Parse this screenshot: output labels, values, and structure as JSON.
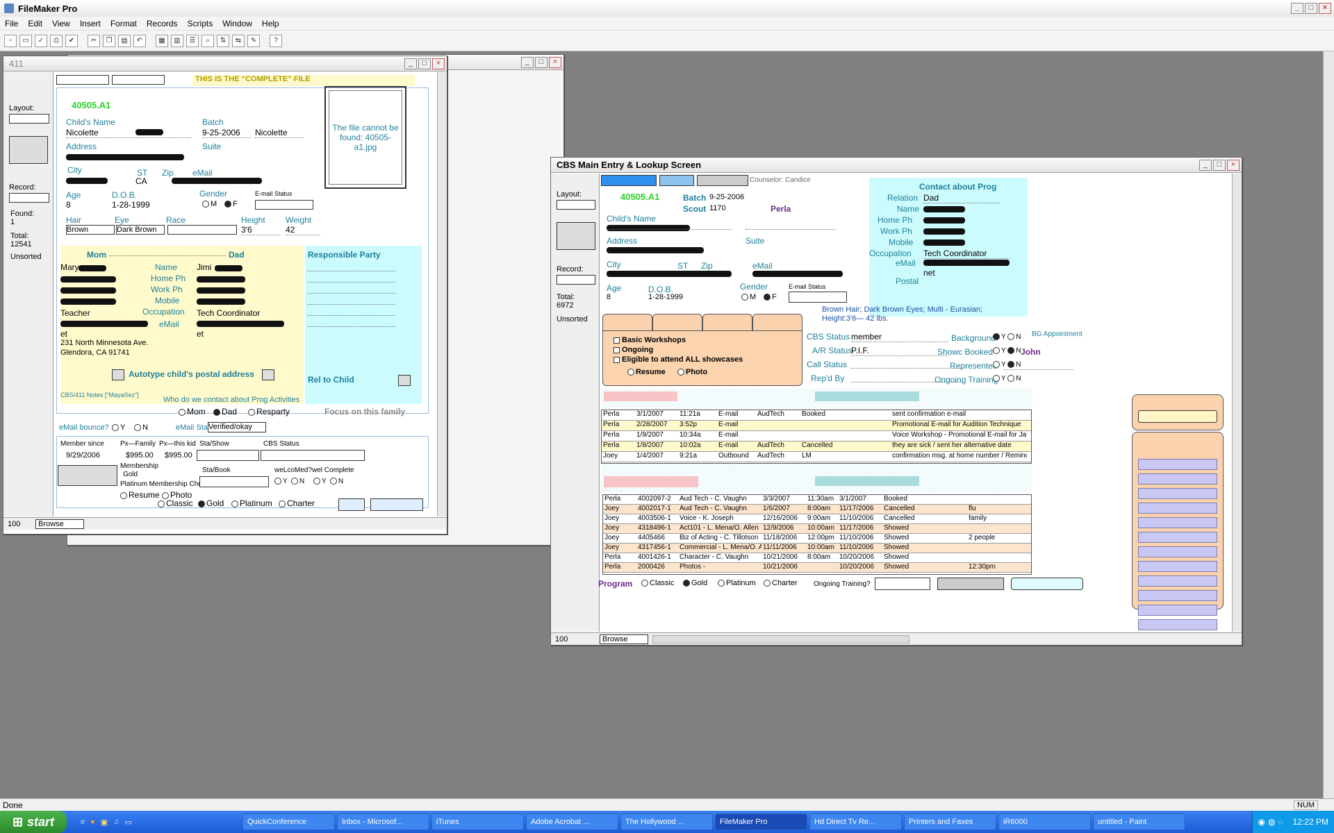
{
  "app": {
    "title": "FileMaker Pro"
  },
  "menu": [
    "File",
    "Edit",
    "View",
    "Insert",
    "Format",
    "Records",
    "Scripts",
    "Window",
    "Help"
  ],
  "toolbar_icons": [
    "new-icon",
    "open-icon",
    "check-icon",
    "print-icon",
    "spellcheck-icon",
    "cut-icon",
    "copy-icon",
    "paste-icon",
    "undo-icon",
    "layout-icon",
    "table-icon",
    "list-icon",
    "find-icon",
    "sort-icon",
    "replace-icon",
    "script-icon",
    "help-icon"
  ],
  "win411": {
    "title": "411",
    "banner": "THIS IS THE “COMPLETE” FILE",
    "record_id": "40505.A1",
    "layout_label": "Layout:",
    "record_label": "Record:",
    "found_label": "Found:",
    "found": "1",
    "total_label": "Total:",
    "total": "12541",
    "sort": "Unsorted",
    "childs_name_label": "Child's Name",
    "childs_first": "Nicolette",
    "batch_label": "Batch",
    "batch_date": "9-25-2006",
    "batch_name": "Nicolette",
    "address_label": "Address",
    "suite_label": "Suite",
    "city_label": "City",
    "st_label": "ST",
    "st": "CA",
    "zip_label": "Zip",
    "email_label": "eMail",
    "age_label": "Age",
    "age": "8",
    "dob_label": "D.O.B.",
    "dob": "1-28-1999",
    "gender_label": "Gender",
    "gender_m": "M",
    "gender_f": "F",
    "email_status_label": "E-mail Status",
    "hair_label": "Hair",
    "hair": "Brown",
    "eye_label": "Eye",
    "eye": "Dark Brown",
    "race_label": "Race",
    "height_label": "Height",
    "height": "3'6",
    "weight_label": "Weight",
    "weight": "42",
    "photo_msg": "The file cannot be found: 40505-a1.jpg",
    "mom_label": "Mom",
    "dad_label": "Dad",
    "mom_name": "Mary",
    "mom_occ": "Teacher",
    "mom_email_tail": "et",
    "mom_addr1": "231 North Minnesota Ave.",
    "mom_addr2": "Glendora, CA 91741",
    "name_label": "Name",
    "homeph_label": "Home Ph",
    "workph_label": "Work Ph",
    "mobile_label": "Mobile",
    "occupation_label": "Occupation",
    "dad_name": "Jimi",
    "dad_occ": "Tech Coordinator",
    "dad_email_tail": "et",
    "resp_party_label": "Responsible Party",
    "autotype_label": "Autotype child's postal address",
    "rel_to_child_label": "Rel to Child",
    "notes_label": "CBS/411 Notes [\"MayaSez\"]",
    "contact_q": "Who do we contact about Prog Activities",
    "contact_mom": "Mom",
    "contact_dad": "Dad",
    "contact_resp": "Resparty",
    "focus_label": "Focus on this family",
    "ebounce_label": "eMail bounce?",
    "y": "Y",
    "n": "N",
    "email_sta_label": "eMail Sta",
    "email_sta_val": "Verified/okay",
    "member_since_label": "Member since",
    "member_since": "9/29/2006",
    "px_family_label": "Px—Family",
    "px_family": "$995.00",
    "px_kid_label": "Px—this kid",
    "px_kid": "$995.00",
    "sta_show_label": "Sta/Show",
    "cbs_status_label": "CBS Status",
    "membership_label": "Membership",
    "membership": "Gold",
    "platinum_choice_label": "Platinum Membership Choice",
    "resume_label": "Resume",
    "photo_label": "Photo",
    "sta_book_label": "Sta/Book",
    "welcomed_label": "weLcoMed?",
    "welcomplete_label": "wel Complete",
    "classic": "Classic",
    "gold": "Gold",
    "platinum": "Platinum",
    "charter": "Charter",
    "zoom": "100",
    "mode": "Browse"
  },
  "cbs": {
    "title": "CBS Main Entry & Lookup Screen",
    "counselor_label": "Counselor:",
    "counselor": "Candice",
    "record_id": "40505.A1",
    "batch_label": "Batch",
    "batch": "9-25-2006",
    "scout_label": "Scout",
    "scout": "1170",
    "scout_name": "Perla",
    "layout_label": "Layout:",
    "record_label": "Record:",
    "total_label": "Total:",
    "total": "6972",
    "sort": "Unsorted",
    "childs_name_label": "Child's Name",
    "address_label": "Address",
    "suite_label": "Suite",
    "city_label": "City",
    "st_label": "ST",
    "zip_label": "Zip",
    "email_label": "eMail",
    "age_label": "Age",
    "age": "8",
    "dob_label": "D.O.B.",
    "dob": "1-28-1999",
    "gender_label": "Gender",
    "gender_m": "M",
    "gender_f": "F",
    "email_status_label": "E-mail Status",
    "contact_title": "Contact about Prog",
    "relation_label": "Relation",
    "relation": "Dad",
    "name_label": "Name",
    "homeph_label": "Home Ph",
    "workph_label": "Work Ph",
    "mobile_label": "Mobile",
    "occupation_label": "Occupation",
    "occupation": "Tech Coordinator",
    "email2_label": "eMail",
    "email_tail": "net",
    "postal_label": "Postal",
    "desc": "Brown Hair; Dark Brown Eyes; Multi - Eurasian; Height:3'6— 42 lbs.",
    "bg_appt_label": "BG Appointment",
    "checks": [
      "Basic Workshops",
      "Ongoing",
      "Eligible to attend ALL showcases"
    ],
    "resume_label": "Resume",
    "photo_label": "Photo",
    "cbs_status_label": "CBS Status",
    "cbs_status": "member",
    "ar_status_label": "A/R Status",
    "ar_status": "P.I.F.",
    "call_status_label": "Call Status",
    "repd_by_label": "Rep'd By",
    "background_label": "Background",
    "showc_label": "Showc Booked",
    "represented_label": "Represented",
    "ongoing_training_label": "Ongoing Training",
    "y": "Y",
    "n": "N",
    "rep_name": "John",
    "calls": [
      [
        "Perla",
        "3/1/2007",
        "11:21a",
        "E-mail",
        "AudTech",
        "Booked",
        "sent confirmation e-mail"
      ],
      [
        "Perla",
        "2/28/2007",
        "3:52p",
        "E-mail",
        "",
        "",
        "Promotional E-mail for Audition Technique"
      ],
      [
        "Perla",
        "1/9/2007",
        "10:34a",
        "E-mail",
        "",
        "",
        "Voice Workshop - Promotional E-mail for January"
      ],
      [
        "Perla",
        "1/8/2007",
        "10:02a",
        "E-mail",
        "AudTech",
        "Cancelled",
        "they are sick / sent her alternative date"
      ],
      [
        "Joey",
        "1/4/2007",
        "9:21a",
        "Outbound",
        "AudTech",
        "LM",
        "confirmation msg. at home number / Reminder e-"
      ]
    ],
    "bookings": [
      [
        "Perla",
        "4002097-2",
        "Aud Tech - C. Vaughn",
        "3/3/2007",
        "11:30am",
        "3/1/2007",
        "Booked",
        ""
      ],
      [
        "Joey",
        "4002017-1",
        "Aud Tech - C. Vaughn",
        "1/6/2007",
        "8:00am",
        "11/17/2006",
        "Cancelled",
        "flu"
      ],
      [
        "Joey",
        "4003506-1",
        "Voice - K. Joseph",
        "12/16/2006",
        "9:00am",
        "11/10/2006",
        "Cancelled",
        "family"
      ],
      [
        "Joey",
        "4318496-1",
        "Act101 - L. Mena/O. Allen",
        "12/9/2006",
        "10:00am",
        "11/17/2006",
        "Showed",
        ""
      ],
      [
        "Joey",
        "4405466",
        "Biz of Acting - C. Tillotson",
        "11/18/2006",
        "12:00pm",
        "11/10/2006",
        "Showed",
        "2 people"
      ],
      [
        "Joey",
        "4317456-1",
        "Commercial - L. Mena/O. Allen",
        "11/11/2006",
        "10:00am",
        "11/10/2006",
        "Showed",
        ""
      ],
      [
        "Perla",
        "4001426-1",
        "Character - C. Vaughn",
        "10/21/2006",
        "8:00am",
        "10/20/2006",
        "Showed",
        ""
      ],
      [
        "Perla",
        "2000426",
        "Photos -",
        "10/21/2006",
        "",
        "10/20/2006",
        "Showed",
        "12:30pm"
      ]
    ],
    "program_label": "Program",
    "classic": "Classic",
    "gold": "Gold",
    "platinum": "Platinum",
    "charter": "Charter",
    "ongoing_q": "Ongoing Training?",
    "zoom": "100",
    "mode": "Browse"
  },
  "status": {
    "text": "Done",
    "num": "NUM"
  },
  "taskbar": {
    "start": "start",
    "tasks": [
      "QuickConference",
      "Inbox - Microsof...",
      "iTunes",
      "Adobe Acrobat ...",
      "The Hollywood ...",
      "FileMaker Pro",
      "Hd Direct Tv Re...",
      "Printers and Faxes",
      "iR6000",
      "untitled - Paint"
    ],
    "active_index": 5,
    "clock": "12:22 PM"
  }
}
